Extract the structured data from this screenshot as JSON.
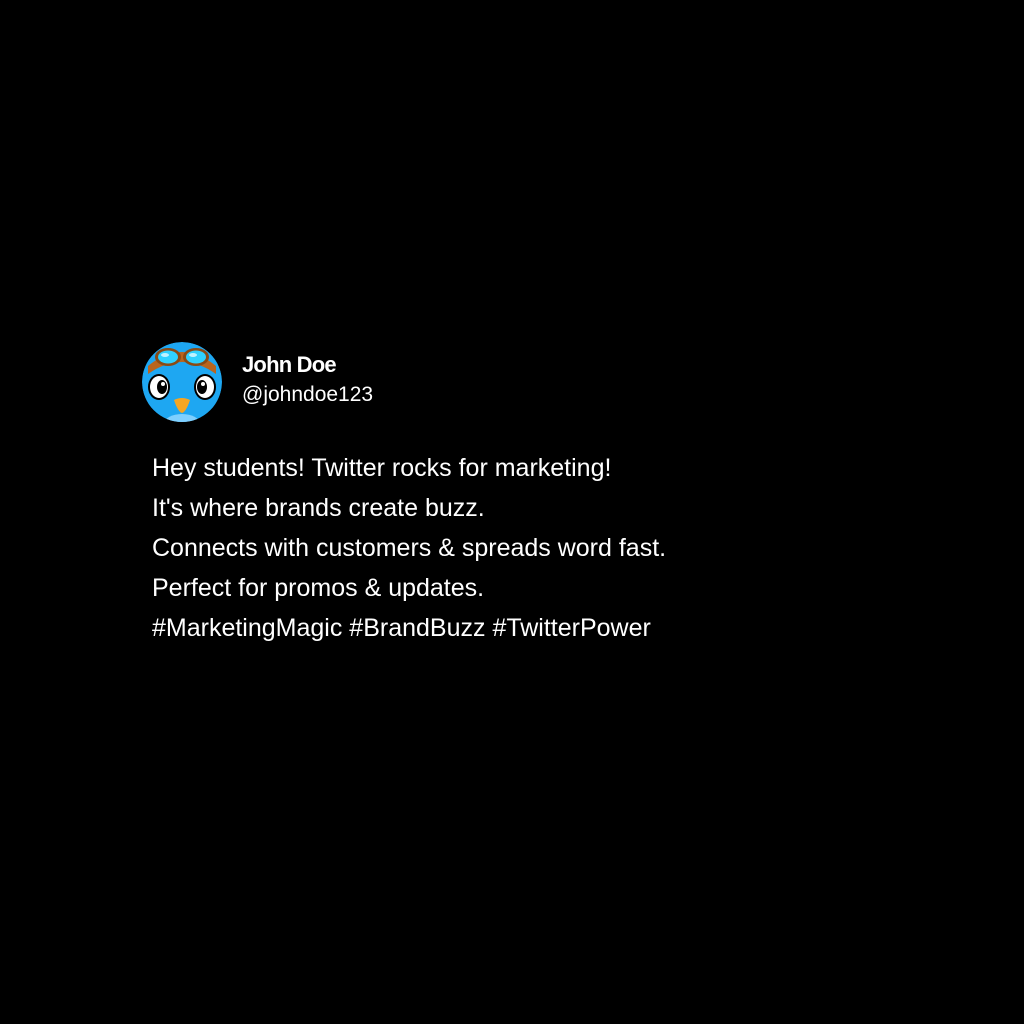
{
  "colors": {
    "background": "#000000",
    "text": "#ffffff",
    "avatar_blue": "#1ea7f2",
    "goggle_band": "#b9651f",
    "goggle_lens": "#2fd1ff"
  },
  "tweet": {
    "avatar_icon": "bird-with-goggles-avatar",
    "display_name": "John Doe",
    "handle": "@johndoe123",
    "lines": [
      "Hey students! Twitter rocks for marketing!",
      "It's where brands create buzz.",
      "Connects with customers & spreads word fast.",
      "Perfect for promos & updates.",
      "#MarketingMagic #BrandBuzz #TwitterPower"
    ]
  }
}
